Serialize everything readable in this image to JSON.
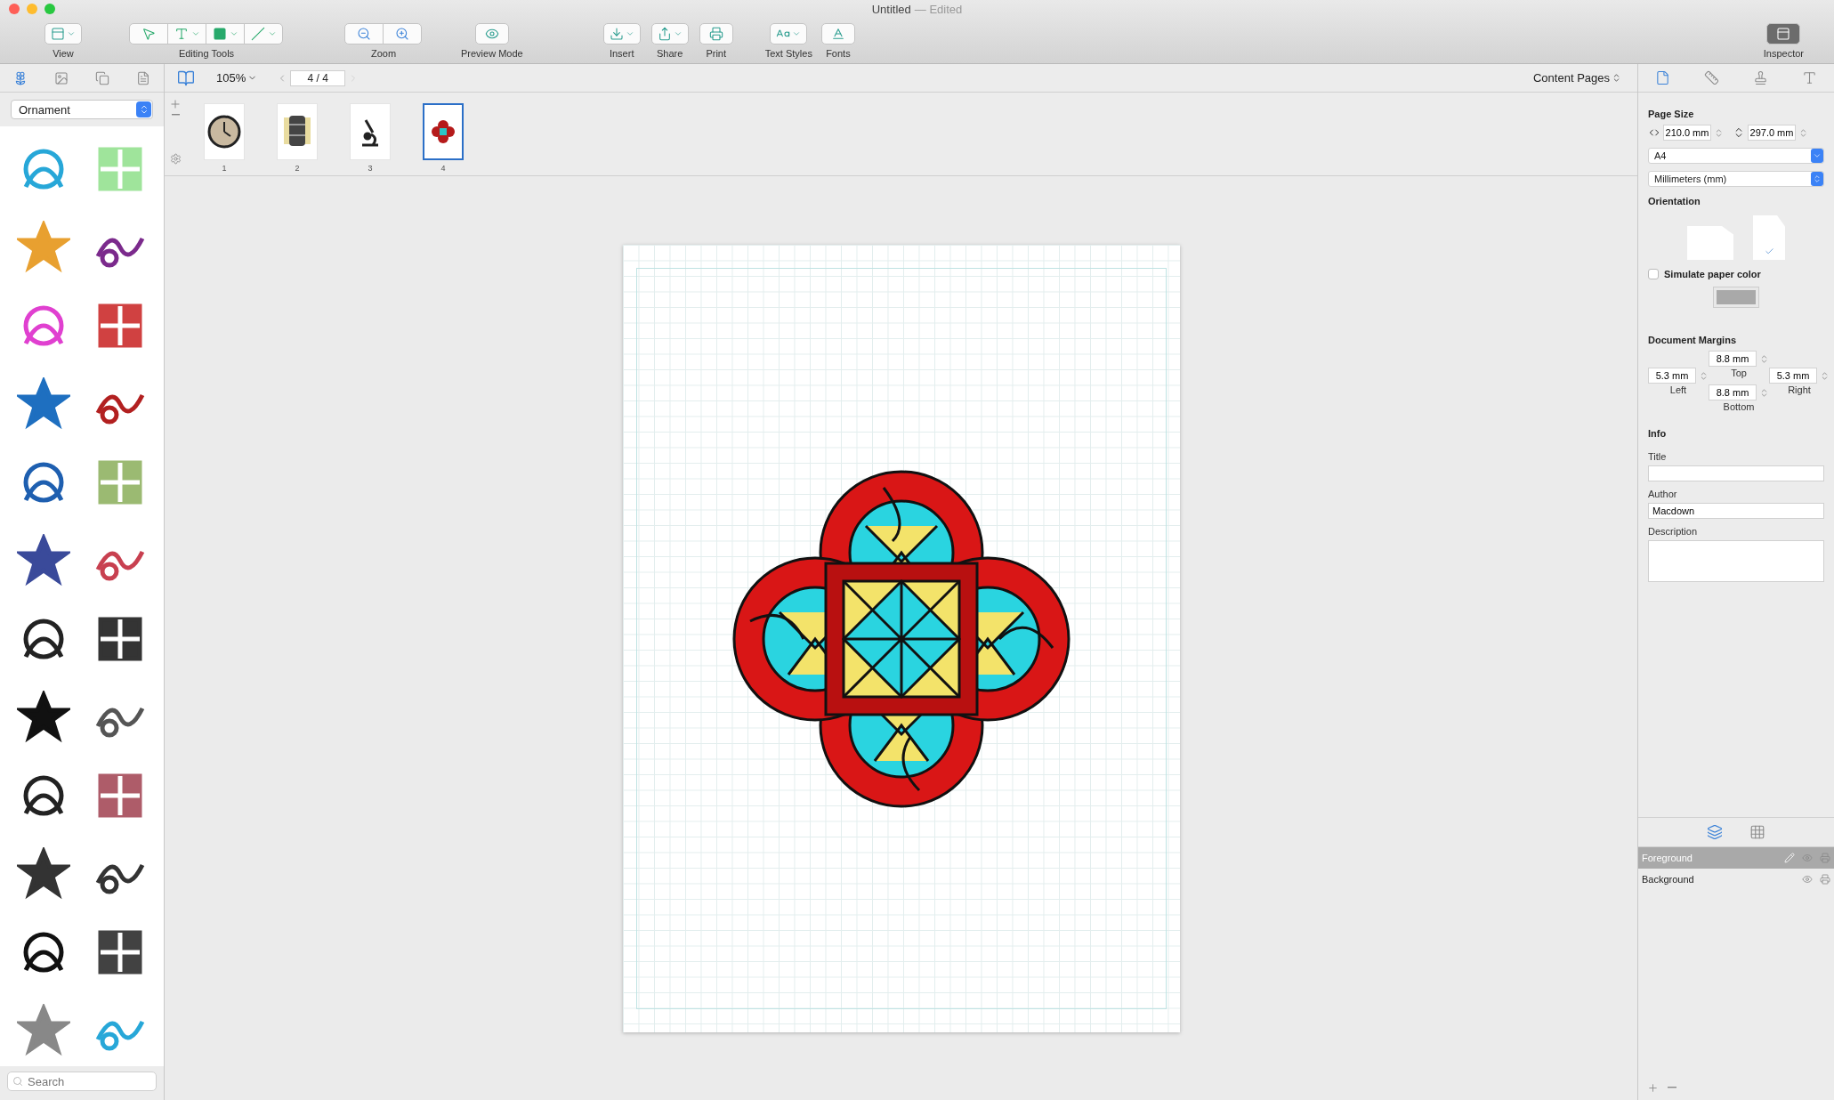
{
  "window": {
    "title": "Untitled",
    "edited": "— Edited"
  },
  "toolbar": {
    "items": [
      {
        "kind": "view",
        "label": "View",
        "on": false
      },
      {
        "kind": "editing",
        "label": "Editing Tools",
        "on": false
      },
      {
        "kind": "zoom",
        "label": "Zoom",
        "on": false
      },
      {
        "kind": "preview",
        "label": "Preview Mode",
        "on": false
      },
      {
        "kind": "insert",
        "label": "Insert",
        "on": false
      },
      {
        "kind": "share",
        "label": "Share",
        "on": false
      },
      {
        "kind": "print",
        "label": "Print",
        "on": false
      },
      {
        "kind": "textstyles",
        "label": "Text Styles",
        "on": false
      },
      {
        "kind": "fonts",
        "label": "Fonts",
        "on": false
      },
      {
        "kind": "inspector",
        "label": "Inspector",
        "on": true
      }
    ]
  },
  "sidebar": {
    "tabs": [
      {
        "kind": "ornament",
        "selected": true
      },
      {
        "kind": "image",
        "selected": false
      },
      {
        "kind": "shapes",
        "selected": false
      },
      {
        "kind": "text",
        "selected": false
      }
    ],
    "category": "Ornament",
    "search": {
      "placeholder": "Search"
    }
  },
  "navbar": {
    "zoom": "105%",
    "page": "4 / 4",
    "section": "Content Pages"
  },
  "thumbnails": [
    {
      "kind": "clock",
      "number": "1",
      "selected": false
    },
    {
      "kind": "barrel",
      "number": "2",
      "selected": false
    },
    {
      "kind": "microscope",
      "number": "3",
      "selected": false
    },
    {
      "kind": "quatrefoil",
      "number": "4",
      "selected": true
    }
  ],
  "inspector": {
    "tabs": [
      {
        "kind": "document",
        "selected": true
      },
      {
        "kind": "layout",
        "selected": false
      },
      {
        "kind": "style",
        "selected": false
      },
      {
        "kind": "text",
        "selected": false
      }
    ],
    "page_size": {
      "heading": "Page Size",
      "width": "210.0 mm",
      "height": "297.0 mm",
      "paper": "A4",
      "units": "Millimeters (mm)"
    },
    "orientation": {
      "heading": "Orientation",
      "options": [
        {
          "kind": "landscape",
          "selected": false
        },
        {
          "kind": "portrait",
          "selected": true
        }
      ]
    },
    "simulate_paper_color": {
      "label": "Simulate paper color",
      "checked": false
    },
    "margins": {
      "heading": "Document Margins",
      "top": {
        "value": "8.8 mm",
        "label": "Top"
      },
      "left": {
        "value": "5.3 mm",
        "label": "Left"
      },
      "right": {
        "value": "5.3 mm",
        "label": "Right"
      },
      "bottom": {
        "value": "8.8 mm",
        "label": "Bottom"
      }
    },
    "info": {
      "heading": "Info",
      "fields": [
        {
          "kind": "line",
          "label": "Title"
        },
        {
          "kind": "line",
          "label": "Author",
          "value": "Macdown"
        },
        {
          "kind": "area",
          "label": "Description"
        }
      ]
    }
  },
  "layers": {
    "tabs": [
      {
        "kind": "layers",
        "selected": true
      },
      {
        "kind": "grid",
        "selected": false
      }
    ],
    "items": [
      {
        "name": "Foreground",
        "selected": true
      },
      {
        "name": "Background",
        "selected": false
      }
    ]
  }
}
